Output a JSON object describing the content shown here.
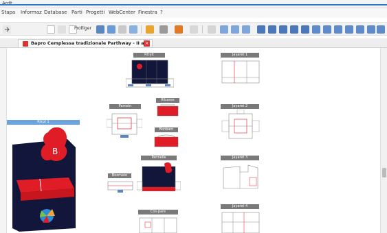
{
  "window": {
    "title": "Ardt"
  },
  "menu": {
    "items": [
      "Stapa",
      "Informaz",
      "Database",
      "Parti",
      "Progetti",
      "WebCenter",
      "Finestra",
      "?"
    ]
  },
  "toolbar": {
    "profile_label": "Profilger"
  },
  "tab": {
    "title": "Bapro Cemplessa tradizionale Parthway - II ard"
  },
  "parts": [
    {
      "label": "Rtryit"
    },
    {
      "label": "Jayaret 1"
    },
    {
      "label": "Parneln"
    },
    {
      "label": "Ribasse"
    },
    {
      "label": "Bonbam"
    },
    {
      "label": "Jayaret 2"
    },
    {
      "label": "Rtrpt 1"
    },
    {
      "label": "Pannelle"
    },
    {
      "label": "Jayaret 3"
    },
    {
      "label": "Boxmate"
    },
    {
      "label": "Jayaret 4"
    },
    {
      "label": "Cos-pare"
    }
  ],
  "colors": {
    "accent": "#2e79c7",
    "brand_red": "#e01d26",
    "dark_navy": "#11163a",
    "label_gray": "#7a7a7a"
  }
}
